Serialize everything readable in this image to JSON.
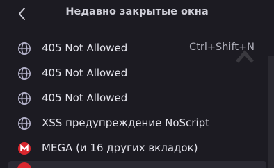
{
  "header": {
    "title": "Недавно закрытые окна",
    "back_icon": "chevron-left-icon"
  },
  "items": [
    {
      "label": "405 Not Allowed",
      "shortcut": "Ctrl+Shift+N",
      "icon": "globe-icon"
    },
    {
      "label": "405 Not Allowed",
      "icon": "globe-icon"
    },
    {
      "label": "405 Not Allowed",
      "icon": "globe-icon"
    },
    {
      "label": "XSS предупреждение NoScript",
      "icon": "globe-icon"
    },
    {
      "label": "MEGA (и 16 других вкладок)",
      "icon": "mega-icon"
    }
  ],
  "colors": {
    "background": "#1c1b22",
    "text": "#e4e4ec",
    "globe_icon": "#b3b1c9",
    "mega_brand": "#d9272e"
  }
}
